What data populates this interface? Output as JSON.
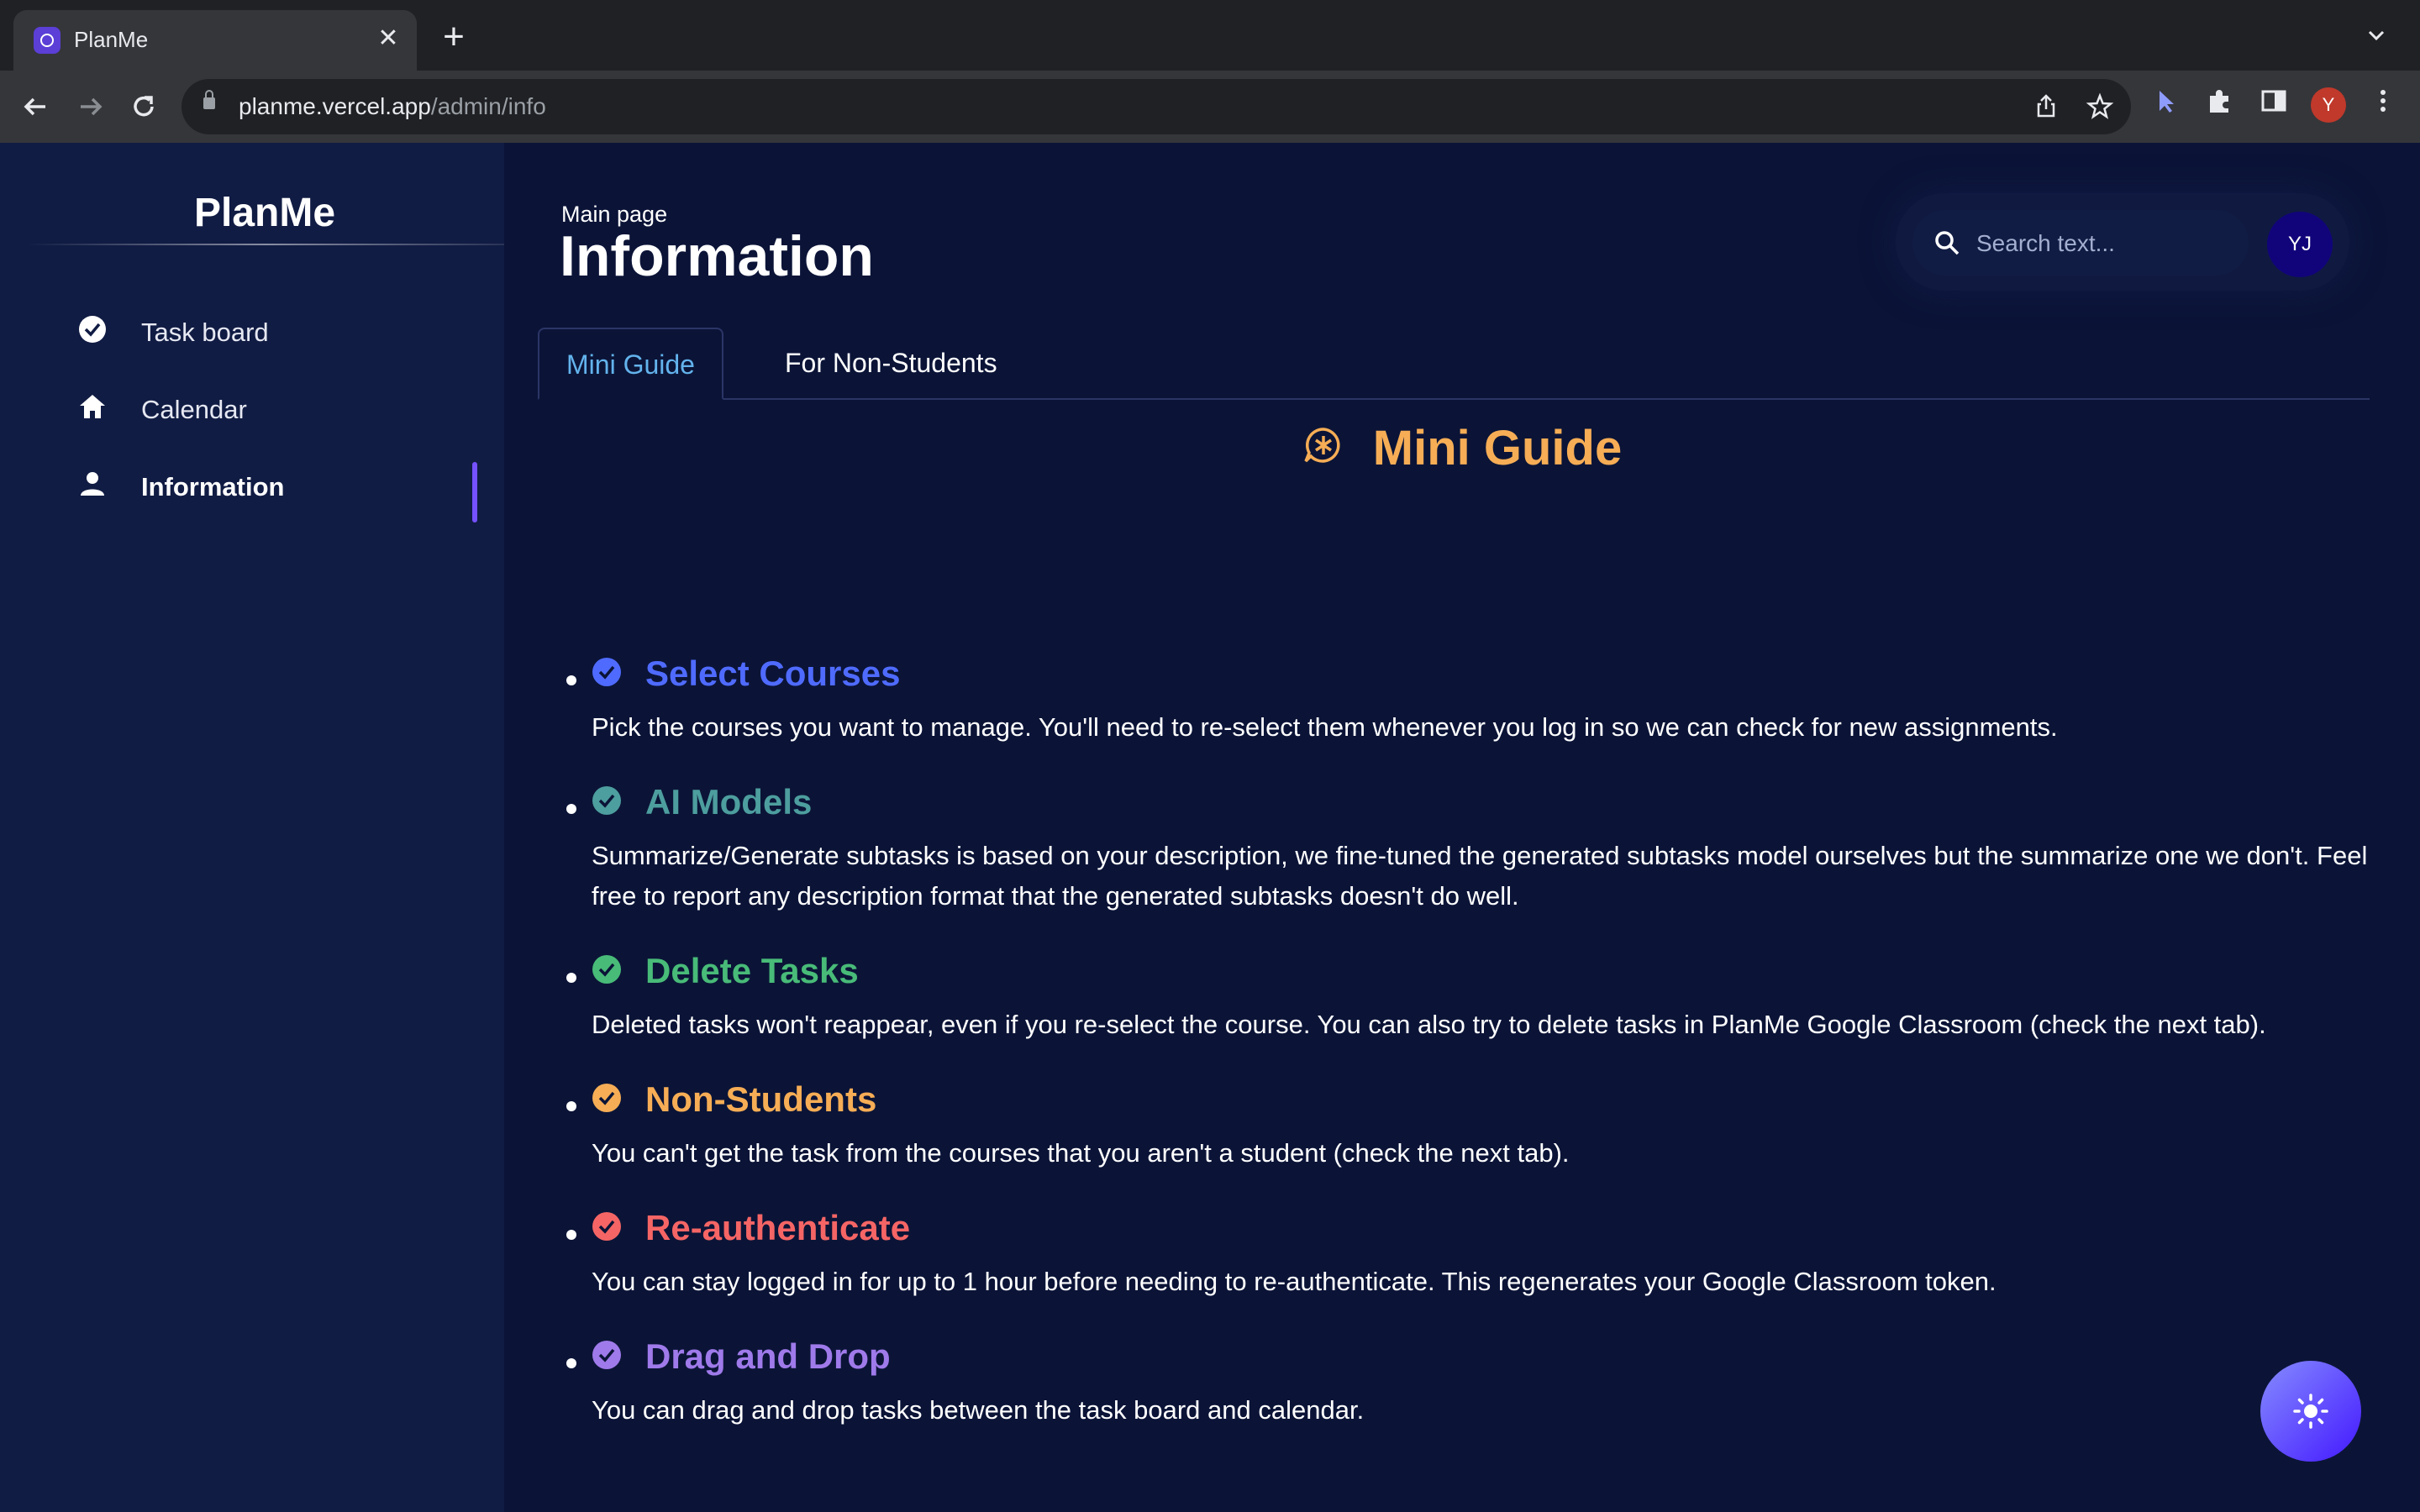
{
  "browser": {
    "tab_title": "PlanMe",
    "tab_close": "✕",
    "new_tab": "+",
    "url_host": "planme.vercel.app",
    "url_path": "/admin/info",
    "profile_initial": "Y"
  },
  "sidebar": {
    "brand": "PlanMe",
    "items": [
      {
        "label": "Task board",
        "icon": "check-circle-icon"
      },
      {
        "label": "Calendar",
        "icon": "home-icon"
      },
      {
        "label": "Information",
        "icon": "person-icon",
        "active": true
      }
    ]
  },
  "header": {
    "breadcrumb": "Main page",
    "title": "Information",
    "search_placeholder": "Search text...",
    "avatar_initials": "YJ"
  },
  "tabs": [
    {
      "label": "Mini Guide",
      "active": true
    },
    {
      "label": "For Non-Students",
      "active": false
    }
  ],
  "guide": {
    "title": "Mini Guide",
    "items": [
      {
        "heading": "Select Courses",
        "color": "#4f6bff",
        "text": "Pick the courses you want to manage. You'll need to re-select them whenever you log in so we can check for new assignments."
      },
      {
        "heading": "AI Models",
        "color": "#4d9e9e",
        "text": "Summarize/Generate subtasks is based on your description, we fine-tuned the generated subtasks model ourselves but the summarize one we don't. Feel free to report any description format that the generated subtasks doesn't do well."
      },
      {
        "heading": "Delete Tasks",
        "color": "#48bb78",
        "text": "Deleted tasks won't reappear, even if you re-select the course. You can also try to delete tasks in PlanMe Google Classroom (check the next tab)."
      },
      {
        "heading": "Non-Students",
        "color": "#f6ad55",
        "text": "You can't get the task from the courses that you aren't a student (check the next tab)."
      },
      {
        "heading": "Re-authenticate",
        "color": "#f56565",
        "text": "You can stay logged in for up to 1 hour before needing to re-authenticate. This regenerates your Google Classroom token."
      },
      {
        "heading": "Drag and Drop",
        "color": "#9f7aea",
        "text": "You can drag and drop tasks between the task board and calendar."
      }
    ]
  }
}
